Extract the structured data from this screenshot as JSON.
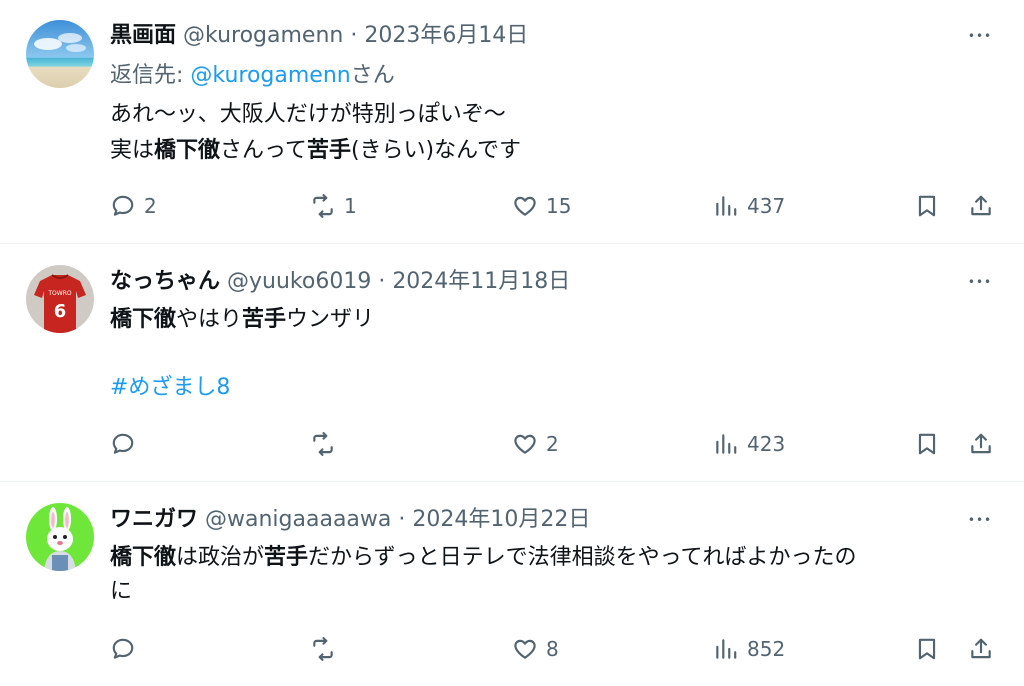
{
  "tweets": [
    {
      "display_name": "黒画面",
      "handle": "@kurogamenn",
      "sep": " · ",
      "date": "2023年6月14日",
      "reply_prefix": "返信先: ",
      "reply_to": "@kurogamenn",
      "reply_suffix": "さん",
      "line1": "あれ〜ッ、大阪人だけが特別っぽいぞ〜",
      "line2_a": "実は",
      "line2_b": "橋下徹",
      "line2_c": "さんって",
      "line2_d": "苦手",
      "line2_e": "(きらい)なんです",
      "replies": "2",
      "retweets": "1",
      "likes": "15",
      "views": "437"
    },
    {
      "display_name": "なっちゃん",
      "handle": "@yuuko6019",
      "sep": " · ",
      "date": "2024年11月18日",
      "line1_a": "橋下徹",
      "line1_b": "やはり",
      "line1_c": "苦手",
      "line1_d": "ウンザリ",
      "hashtag": "#めざまし8",
      "replies": "",
      "retweets": "",
      "likes": "2",
      "views": "423"
    },
    {
      "display_name": "ワニガワ",
      "handle": "@wanigaaaaawa",
      "sep": " · ",
      "date": "2024年10月22日",
      "line1_a": "橋下徹",
      "line1_b": "は政治が",
      "line1_c": "苦手",
      "line1_d": "だからずっと日テレで法律相談をやってればよかったの",
      "line2": "に",
      "replies": "",
      "retweets": "",
      "likes": "8",
      "views": "852"
    }
  ],
  "icons": {
    "more": "more-icon",
    "reply": "reply-icon",
    "retweet": "retweet-icon",
    "like": "heart-icon",
    "views": "views-icon",
    "bookmark": "bookmark-icon",
    "share": "share-icon"
  },
  "colors": {
    "link": "#1d9bf0",
    "muted": "#536471",
    "text": "#0f1419",
    "divider": "#eff3f4"
  },
  "more_glyph": "•••"
}
